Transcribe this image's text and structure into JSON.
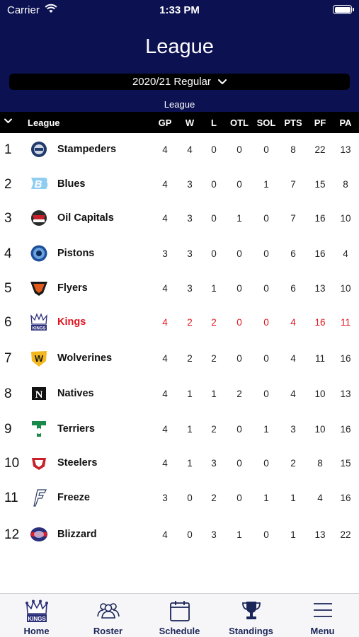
{
  "status": {
    "carrier": "Carrier",
    "time": "1:33 PM"
  },
  "header": {
    "title": "League",
    "season": "2020/21 Regular",
    "subtitle": "League"
  },
  "table": {
    "league_label": "League",
    "columns": [
      "GP",
      "W",
      "L",
      "OTL",
      "SOL",
      "PTS",
      "PF",
      "PA"
    ],
    "rows": [
      {
        "rank": "1",
        "team": "Stampeders",
        "logo": "stampeders-logo",
        "stats": [
          "4",
          "4",
          "0",
          "0",
          "0",
          "8",
          "22",
          "13"
        ]
      },
      {
        "rank": "2",
        "team": "Blues",
        "logo": "blues-logo",
        "stats": [
          "4",
          "3",
          "0",
          "0",
          "1",
          "7",
          "15",
          "8"
        ]
      },
      {
        "rank": "3",
        "team": "Oil Capitals",
        "logo": "oil-capitals-logo",
        "stats": [
          "4",
          "3",
          "0",
          "1",
          "0",
          "7",
          "16",
          "10"
        ]
      },
      {
        "rank": "4",
        "team": "Pistons",
        "logo": "pistons-logo",
        "stats": [
          "3",
          "3",
          "0",
          "0",
          "0",
          "6",
          "16",
          "4"
        ]
      },
      {
        "rank": "5",
        "team": "Flyers",
        "logo": "flyers-logo",
        "stats": [
          "4",
          "3",
          "1",
          "0",
          "0",
          "6",
          "13",
          "10"
        ]
      },
      {
        "rank": "6",
        "team": "Kings",
        "logo": "kings-logo",
        "highlight": true,
        "stats": [
          "4",
          "2",
          "2",
          "0",
          "0",
          "4",
          "16",
          "11"
        ]
      },
      {
        "rank": "7",
        "team": "Wolverines",
        "logo": "wolverines-logo",
        "stats": [
          "4",
          "2",
          "2",
          "0",
          "0",
          "4",
          "11",
          "16"
        ]
      },
      {
        "rank": "8",
        "team": "Natives",
        "logo": "natives-logo",
        "stats": [
          "4",
          "1",
          "1",
          "2",
          "0",
          "4",
          "10",
          "13"
        ]
      },
      {
        "rank": "9",
        "team": "Terriers",
        "logo": "terriers-logo",
        "stats": [
          "4",
          "1",
          "2",
          "0",
          "1",
          "3",
          "10",
          "16"
        ]
      },
      {
        "rank": "10",
        "team": "Steelers",
        "logo": "steelers-logo",
        "stats": [
          "4",
          "1",
          "3",
          "0",
          "0",
          "2",
          "8",
          "15"
        ]
      },
      {
        "rank": "11",
        "team": "Freeze",
        "logo": "freeze-logo",
        "stats": [
          "3",
          "0",
          "2",
          "0",
          "1",
          "1",
          "4",
          "16"
        ]
      },
      {
        "rank": "12",
        "team": "Blizzard",
        "logo": "blizzard-logo",
        "stats": [
          "4",
          "0",
          "3",
          "1",
          "0",
          "1",
          "13",
          "22"
        ]
      }
    ]
  },
  "tabbar": {
    "tabs": [
      {
        "label": "Home",
        "icon": "kings-crown-icon"
      },
      {
        "label": "Roster",
        "icon": "people-icon"
      },
      {
        "label": "Schedule",
        "icon": "calendar-icon"
      },
      {
        "label": "Standings",
        "icon": "trophy-icon"
      },
      {
        "label": "Menu",
        "icon": "hamburger-menu-icon"
      }
    ]
  },
  "colors": {
    "header_bg": "#0c1152",
    "highlight": "#e0141e",
    "tab_tint": "#1a2558"
  }
}
